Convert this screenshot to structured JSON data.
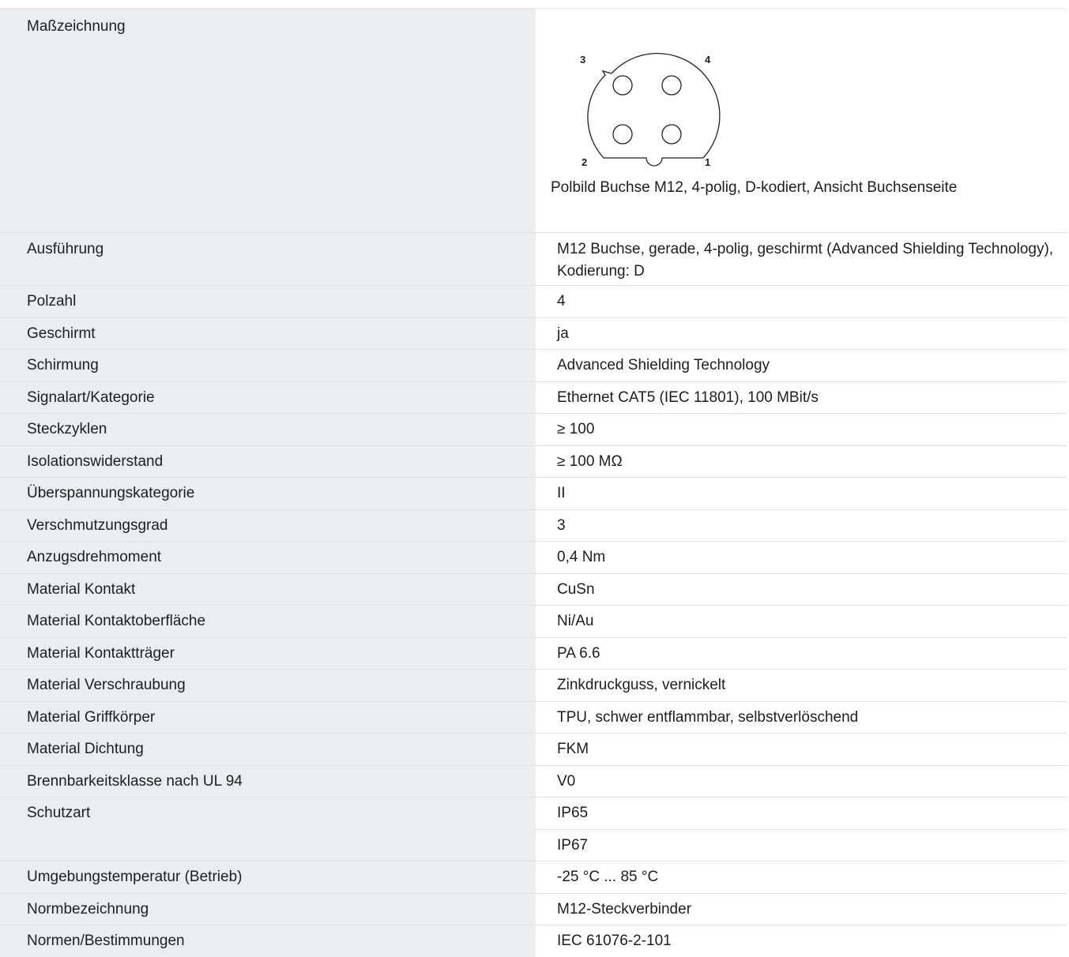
{
  "drawing": {
    "label": "Maßzeichnung",
    "pins": [
      "3",
      "4",
      "2",
      "1"
    ],
    "caption": "Polbild Buchse M12, 4-polig, D-kodiert, Ansicht Buchsenseite"
  },
  "rows": [
    {
      "label": "Ausführung",
      "value": "M12 Buchse, gerade, 4-polig, geschirmt (Advanced Shielding Technology), Kodierung: D"
    },
    {
      "label": "Polzahl",
      "value": "4"
    },
    {
      "label": "Geschirmt",
      "value": "ja"
    },
    {
      "label": "Schirmung",
      "value": "Advanced Shielding Technology"
    },
    {
      "label": "Signalart/Kategorie",
      "value": "Ethernet CAT5 (IEC 11801), 100 MBit/s"
    },
    {
      "label": "Steckzyklen",
      "value": "≥ 100"
    },
    {
      "label": "Isolationswiderstand",
      "value": "≥ 100 MΩ"
    },
    {
      "label": "Überspannungskategorie",
      "value": "II"
    },
    {
      "label": "Verschmutzungsgrad",
      "value": "3"
    },
    {
      "label": "Anzugsdrehmoment",
      "value": "0,4 Nm"
    },
    {
      "label": "Material Kontakt",
      "value": "CuSn"
    },
    {
      "label": "Material Kontaktoberfläche",
      "value": "Ni/Au"
    },
    {
      "label": "Material Kontaktträger",
      "value": "PA 6.6"
    },
    {
      "label": "Material Verschraubung",
      "value": "Zinkdruckguss, vernickelt"
    },
    {
      "label": "Material Griffkörper",
      "value": "TPU, schwer entflammbar, selbstverlöschend"
    },
    {
      "label": "Material Dichtung",
      "value": "FKM"
    },
    {
      "label": "Brennbarkeitsklasse nach UL 94",
      "value": "V0"
    },
    {
      "label": "Schutzart",
      "value": "IP65",
      "value2": "IP67"
    },
    {
      "label": "Umgebungstemperatur (Betrieb)",
      "value": "-25 °C ... 85 °C"
    },
    {
      "label": "Normbezeichnung",
      "value": "M12-Steckverbinder"
    },
    {
      "label": "Normen/Bestimmungen",
      "value": "IEC 61076-2-101"
    }
  ]
}
